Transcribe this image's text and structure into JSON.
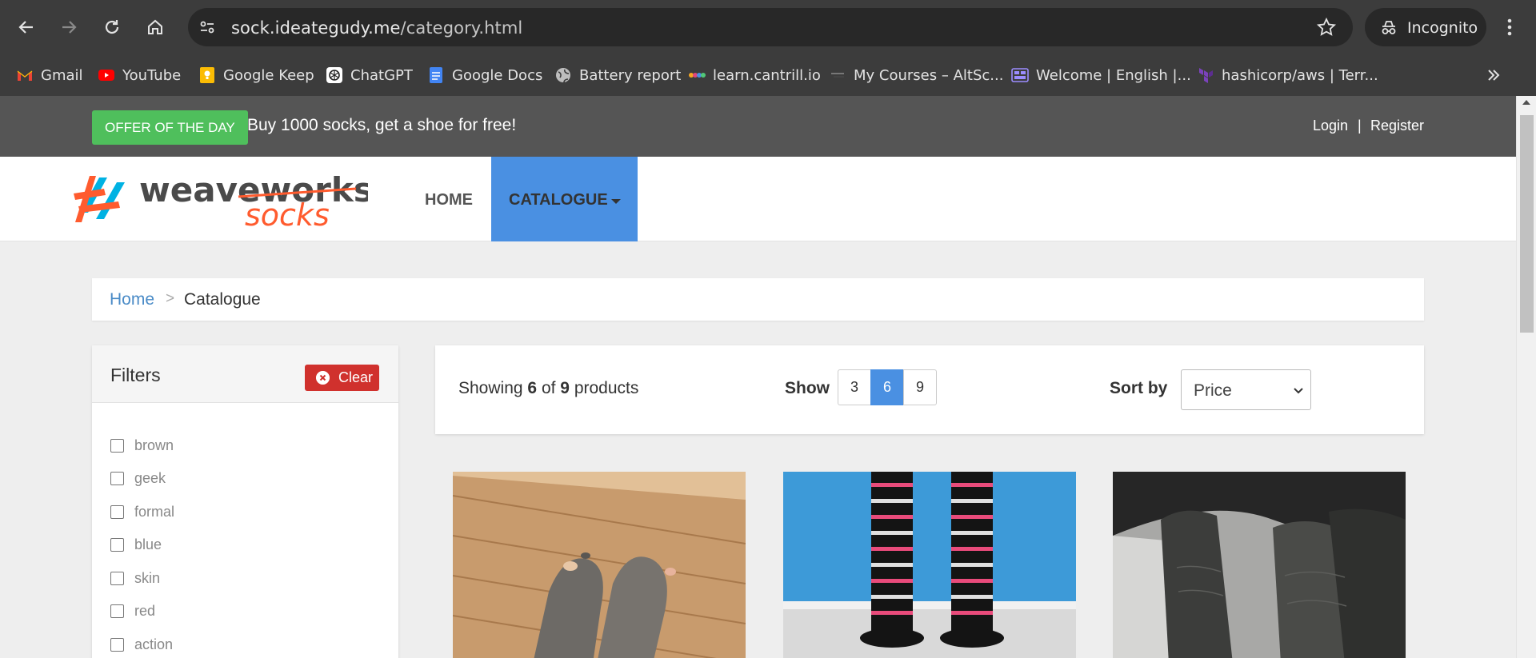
{
  "browser": {
    "url_host": "sock.ideategudy.me",
    "url_path": "/category.html",
    "incognito_label": "Incognito",
    "bookmarks": [
      {
        "label": "Gmail",
        "icon": "gmail-icon"
      },
      {
        "label": "YouTube",
        "icon": "youtube-icon"
      },
      {
        "label": "Google Keep",
        "icon": "keep-icon"
      },
      {
        "label": "ChatGPT",
        "icon": "chatgpt-icon"
      },
      {
        "label": "Google Docs",
        "icon": "docs-icon"
      },
      {
        "label": "Battery report",
        "icon": "globe-icon"
      },
      {
        "label": "learn.cantrill.io",
        "icon": "cantrill-icon"
      },
      {
        "label": "My Courses – AltSc...",
        "icon": "altschool-icon"
      },
      {
        "label": "Welcome | English |...",
        "icon": "welcome-icon"
      },
      {
        "label": "hashicorp/aws | Terr...",
        "icon": "terraform-icon"
      }
    ]
  },
  "topbar": {
    "offer_badge": "OFFER OF THE DAY",
    "offer_text": "Buy 1000 socks, get a shoe for free!",
    "login": "Login",
    "separator": "|",
    "register": "Register"
  },
  "navbar": {
    "logo_word_1": "weaveworks",
    "logo_word_2": "socks",
    "home": "HOME",
    "catalogue": "CATALOGUE"
  },
  "breadcrumb": {
    "home": "Home",
    "separator": ">",
    "current": "Catalogue"
  },
  "filters": {
    "title": "Filters",
    "clear": "Clear",
    "items": [
      "brown",
      "geek",
      "formal",
      "blue",
      "skin",
      "red",
      "action"
    ]
  },
  "toolbar": {
    "showing_prefix": "Showing",
    "showing_count": "6",
    "showing_of": "of",
    "showing_total": "9",
    "showing_suffix": "products",
    "show_label": "Show",
    "page_sizes": [
      "3",
      "6",
      "9"
    ],
    "active_page_size": "6",
    "sort_label": "Sort by",
    "sort_value": "Price"
  },
  "colors": {
    "accent": "#4a90e2",
    "offer_green": "#4fbf5c",
    "clear_red": "#d0312d",
    "topbar": "#555555"
  }
}
